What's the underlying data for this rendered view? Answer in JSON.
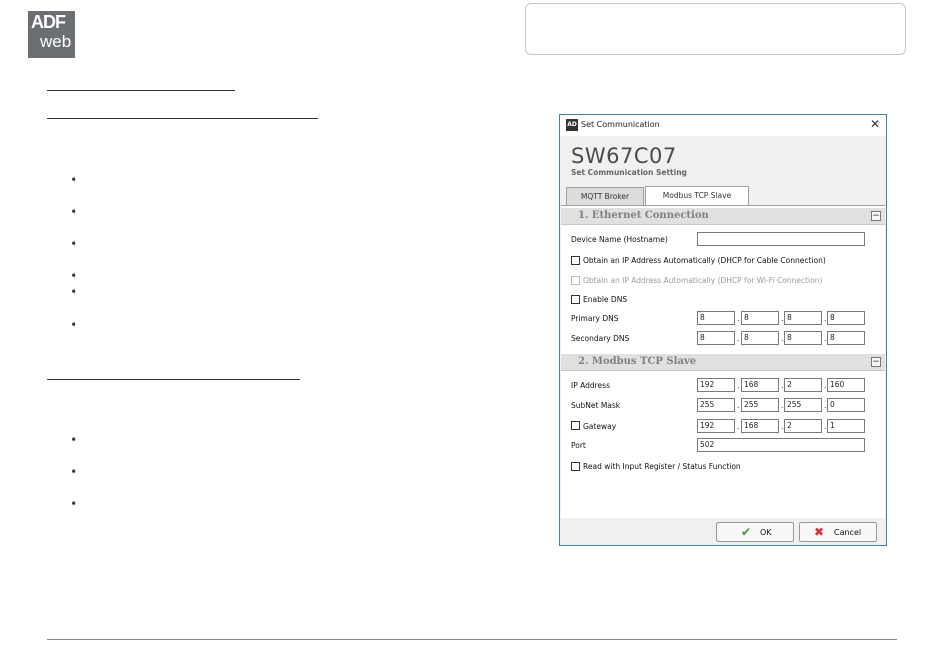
{
  "logo": {
    "line1": "ADF",
    "line2": "web"
  },
  "dialog": {
    "title": "Set Communication",
    "close_glyph": "✕",
    "device_code": "SW67C07",
    "subtitle": "Set Communication Setting",
    "tabs": [
      {
        "label": "MQTT Broker",
        "active": false
      },
      {
        "label": "Modbus TCP Slave",
        "active": true
      }
    ],
    "section1": {
      "title": "1. Ethernet Connection",
      "collapse_glyph": "−",
      "device_name_label": "Device Name (Hostname)",
      "device_name_value": "",
      "dhcp_cable_label": "Obtain an IP Address Automatically (DHCP for Cable Connection)",
      "dhcp_wifi_label": "Obtain an IP Address Automatically (DHCP for Wi-Fi Connection)",
      "enable_dns_label": "Enable DNS",
      "primary_dns_label": "Primary DNS",
      "primary_dns": [
        "8",
        "8",
        "8",
        "8"
      ],
      "secondary_dns_label": "Secondary DNS",
      "secondary_dns": [
        "8",
        "8",
        "8",
        "8"
      ]
    },
    "section2": {
      "title": "2. Modbus TCP Slave",
      "collapse_glyph": "−",
      "ip_label": "IP Address",
      "ip": [
        "192",
        "168",
        "2",
        "160"
      ],
      "subnet_label": "SubNet Mask",
      "subnet": [
        "255",
        "255",
        "255",
        "0"
      ],
      "gateway_label": "Gateway",
      "gateway": [
        "192",
        "168",
        "2",
        "1"
      ],
      "port_label": "Port",
      "port": "502",
      "read_input_label": "Read with Input Register / Status Function"
    },
    "buttons": {
      "ok_label": "OK",
      "ok_icon": "check-icon",
      "cancel_label": "Cancel",
      "cancel_icon": "x-icon"
    }
  },
  "colors": {
    "dialog_border": "#3c7fb1",
    "section_title": "#808080",
    "check_green": "#3a9a2a",
    "cancel_red": "#d93030"
  }
}
